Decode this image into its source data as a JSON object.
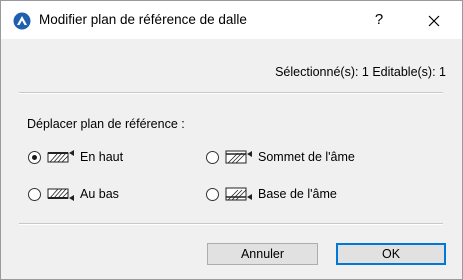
{
  "window": {
    "title": "Modifier plan de référence de dalle",
    "help_label": "?",
    "app_icon": "archicad-app-icon",
    "close_icon": "close-icon"
  },
  "selection": {
    "info": "Sélectionné(s): 1 Editable(s): 1"
  },
  "move_reference": {
    "label": "Déplacer plan de référence :",
    "options": [
      {
        "label": "En haut",
        "icon": "slab-top-icon",
        "checked": true
      },
      {
        "label": "Sommet de l'âme",
        "icon": "slab-core-top-icon",
        "checked": false
      },
      {
        "label": "Au bas",
        "icon": "slab-bottom-icon",
        "checked": false
      },
      {
        "label": "Base de l'âme",
        "icon": "slab-core-bottom-icon",
        "checked": false
      }
    ]
  },
  "buttons": {
    "cancel": "Annuler",
    "ok": "OK"
  }
}
